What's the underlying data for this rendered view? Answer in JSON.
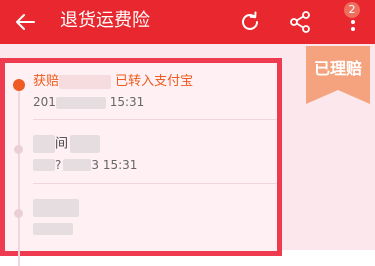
{
  "app_bar": {
    "title": "退货运费险",
    "back_icon": "arrow-left",
    "refresh_icon": "refresh",
    "share_icon": "share",
    "more_icon": "more-vertical",
    "badge_count": "2",
    "bg_color": "#e8282e"
  },
  "status_ribbon": {
    "label": "已理赔",
    "color": "#f5a37e"
  },
  "timeline": [
    {
      "title": "获赔",
      "title_suffix": "已转入支付宝",
      "time_prefix": "201",
      "time_suffix": "15:31",
      "active": true
    },
    {
      "title": "",
      "title_fragment": "间",
      "time_prefix": "?",
      "time_suffix": "3 15:31",
      "active": false
    },
    {
      "title": "",
      "time_prefix": "",
      "time_suffix": "",
      "active": false
    }
  ],
  "colors": {
    "accent": "#ef5a1e",
    "card_border": "#ef3b4f",
    "background": "#fbe7ec"
  }
}
